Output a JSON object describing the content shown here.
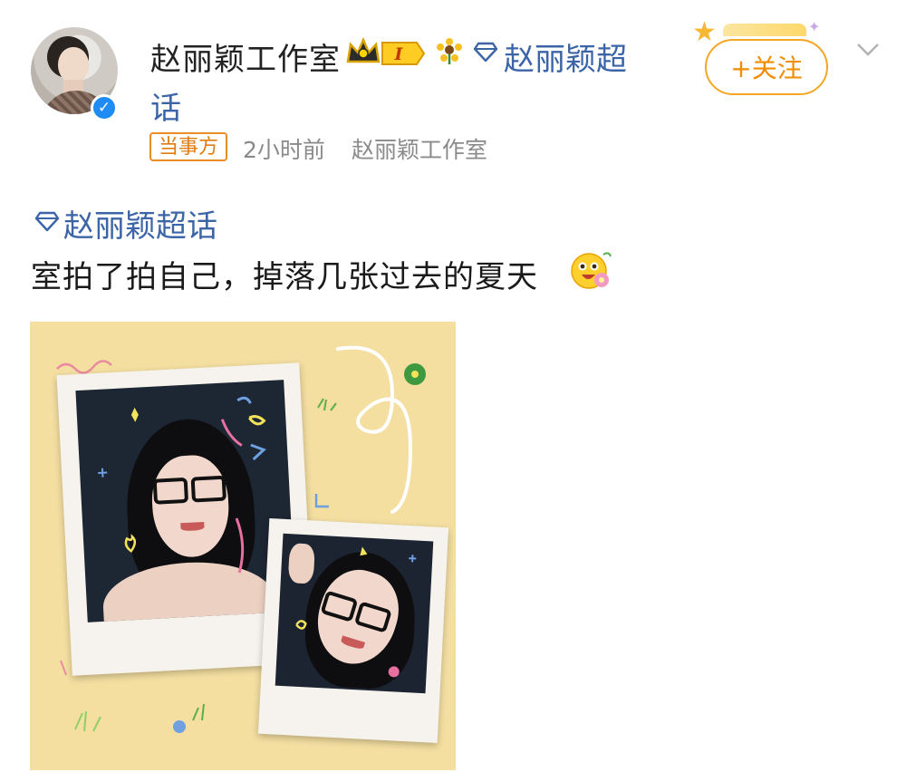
{
  "post": {
    "author_name": "赵丽颖工作室",
    "author_name_suffix": "话",
    "supertopic_inline": "赵丽颖超",
    "level_badge": "I",
    "role_tag": "当事方",
    "time": "2小时前",
    "source": "赵丽颖工作室",
    "follow_label": "+关注",
    "supertopic": "赵丽颖超话",
    "text": "室拍了拍自己，掉落几张过去的夏天",
    "verified_mark": "✓"
  },
  "colors": {
    "link_blue": "#3c65a8",
    "follow_orange": "#f08c00",
    "verified_blue": "#1f8bf5",
    "photo_bg": "#f4dfa1"
  },
  "icons": [
    "avatar",
    "verified-icon",
    "crown-icon",
    "level-badge-icon",
    "sunflower-icon",
    "diamond-icon",
    "chevron-down-icon",
    "emoji-icon"
  ]
}
